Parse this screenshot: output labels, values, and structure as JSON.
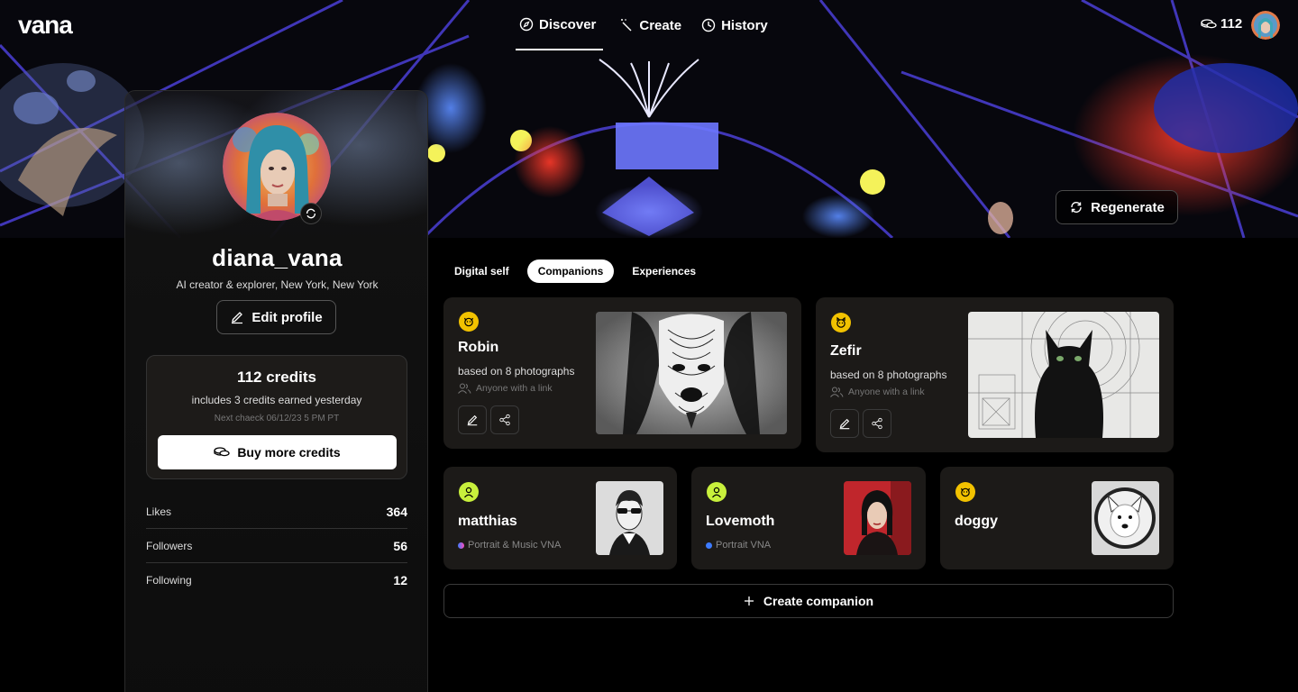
{
  "app": {
    "logo": "vana"
  },
  "nav": {
    "tabs": [
      {
        "label": "Discover",
        "icon": "compass-icon",
        "active": true
      },
      {
        "label": "Create",
        "icon": "magic-wand-icon",
        "active": false
      },
      {
        "label": "History",
        "icon": "clock-icon",
        "active": false
      }
    ],
    "credits": "112"
  },
  "banner": {
    "regenerate_label": "Regenerate"
  },
  "profile": {
    "username": "diana_vana",
    "bio": "AI creator & explorer, New  York, New York",
    "edit_label": "Edit profile",
    "credits": {
      "title": "112 credits",
      "subtitle": "includes 3 credits earned yesterday",
      "next_check": "Next chaeck 06/12/23 5 PM PT",
      "buy_label": "Buy more credits"
    },
    "stats": [
      {
        "label": "Likes",
        "value": "364"
      },
      {
        "label": "Followers",
        "value": "56"
      },
      {
        "label": "Following",
        "value": "12"
      }
    ]
  },
  "tabs": [
    {
      "label": "Digital self",
      "active": false
    },
    {
      "label": "Companions",
      "active": true
    },
    {
      "label": "Experiences",
      "active": false
    }
  ],
  "companions": {
    "featured": [
      {
        "name": "Robin",
        "based": "based on 8 photographs",
        "share": "Anyone with a link",
        "icon": "dog-face-icon"
      },
      {
        "name": "Zefir",
        "based": "based on 8 photographs",
        "share": "Anyone with a link",
        "icon": "cat-face-icon"
      }
    ],
    "small": [
      {
        "name": "matthias",
        "tag": "Portrait & Music VNA",
        "icon": "person-icon"
      },
      {
        "name": "Lovemoth",
        "tag": "Portrait VNA",
        "icon": "person-icon"
      },
      {
        "name": "doggy",
        "tag": "",
        "icon": "dog-face-icon"
      }
    ],
    "create_label": "Create companion"
  },
  "colors": {
    "accent_yellow": "#f2c200",
    "accent_lime": "#c8f03c",
    "blue_dot": "#3d7bff"
  }
}
